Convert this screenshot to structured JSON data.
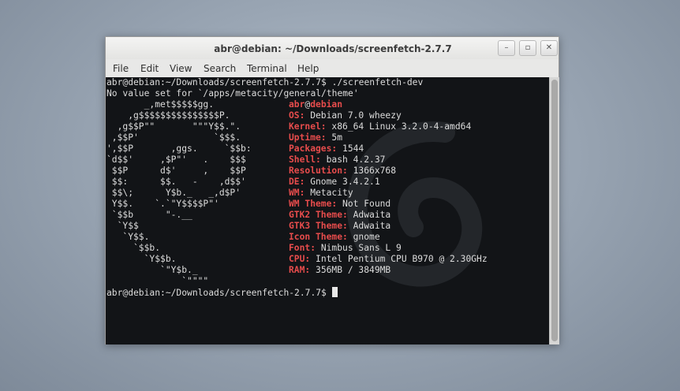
{
  "window": {
    "title": "abr@debian: ~/Downloads/screenfetch-2.7.7",
    "controls": {
      "minimize": "–",
      "maximize": "▫",
      "close": "✕"
    }
  },
  "menu": [
    "File",
    "Edit",
    "View",
    "Search",
    "Terminal",
    "Help"
  ],
  "terminal": {
    "command_line": "abr@debian:~/Downloads/screenfetch-2.7.7$ ./screenfetch-dev",
    "warning": "No value set for `/apps/metacity/general/theme'",
    "ascii_logo": [
      "       _,met$$$$$gg.",
      "    ,g$$$$$$$$$$$$$$$P.",
      "  ,g$$P\"\"       \"\"\"Y$$.\".",
      " ,$$P'              `$$$.",
      "',$$P       ,ggs.     `$$b:",
      "`d$$'     ,$P\"'   .    $$$",
      " $$P      d$'     ,    $$P",
      " $$:      $$.   -    ,d$$'",
      " $$\\;      Y$b._   _,d$P'",
      " Y$$.    `.`\"Y$$$$P\"'",
      " `$$b      \"-.__",
      "  `Y$$",
      "   `Y$$.",
      "     `$$b.",
      "       `Y$$b.",
      "          `\"Y$b._",
      "              `\"\"\"\""
    ],
    "user_host": {
      "user": "abr",
      "at": "@",
      "host": "debian"
    },
    "info": [
      {
        "label": "OS:",
        "value": "Debian 7.0 wheezy"
      },
      {
        "label": "Kernel:",
        "value": "x86_64 Linux 3.2.0-4-amd64"
      },
      {
        "label": "Uptime:",
        "value": "5m"
      },
      {
        "label": "Packages:",
        "value": "1544"
      },
      {
        "label": "Shell:",
        "value": "bash 4.2.37"
      },
      {
        "label": "Resolution:",
        "value": "1366x768"
      },
      {
        "label": "DE:",
        "value": "Gnome 3.4.2.1"
      },
      {
        "label": "WM:",
        "value": "Metacity"
      },
      {
        "label": "WM Theme:",
        "value": "Not Found"
      },
      {
        "label": "GTK2 Theme:",
        "value": "Adwaita"
      },
      {
        "label": "GTK3 Theme:",
        "value": "Adwaita"
      },
      {
        "label": "Icon Theme:",
        "value": "gnome"
      },
      {
        "label": "Font:",
        "value": "Nimbus Sans L 9"
      },
      {
        "label": "CPU:",
        "value": "Intel Pentium CPU B970 @ 2.30GHz"
      },
      {
        "label": "RAM:",
        "value": "356MB / 3849MB"
      }
    ],
    "prompt": "abr@debian:~/Downloads/screenfetch-2.7.7$ "
  },
  "colors": {
    "accent": "#e74c4c",
    "terminal_bg": "#121417",
    "text": "#dcdcdc"
  }
}
